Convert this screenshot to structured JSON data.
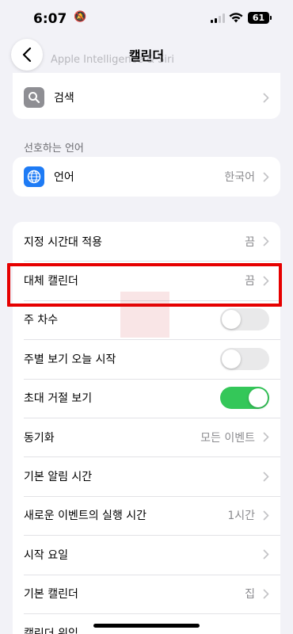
{
  "status": {
    "time": "6:07",
    "battery": "61"
  },
  "nav": {
    "title": "캘린더",
    "faded_item": "Apple Intelligence & Siri"
  },
  "search_row": {
    "label": "검색"
  },
  "language_section": {
    "header": "선호하는 언어",
    "label": "언어",
    "value": "한국어"
  },
  "settings": {
    "timezone": {
      "label": "지정 시간대 적용",
      "value": "끔"
    },
    "alt_calendar": {
      "label": "대체 캘린더",
      "value": "끔"
    },
    "week_numbers": {
      "label": "주 차수",
      "on": false
    },
    "week_view_today": {
      "label": "주별 보기 오늘 시작",
      "on": false
    },
    "declined_invites": {
      "label": "초대 거절 보기",
      "on": true
    },
    "sync": {
      "label": "동기화",
      "value": "모든 이벤트"
    },
    "default_alerts": {
      "label": "기본 알림 시간"
    },
    "event_duration": {
      "label": "새로운 이벤트의 실행 시간",
      "value": "1시간"
    },
    "start_week": {
      "label": "시작 요일"
    },
    "default_calendar": {
      "label": "기본 캘린더",
      "value": "집"
    },
    "location": {
      "label": "캘린더 위임"
    }
  },
  "colors": {
    "accent_green": "#34c759",
    "highlight_red": "#e60000",
    "toggle_off": "#e9e9ea",
    "search_icon_bg": "#8e8e93",
    "globe_icon_bg": "#1e7bf5"
  }
}
